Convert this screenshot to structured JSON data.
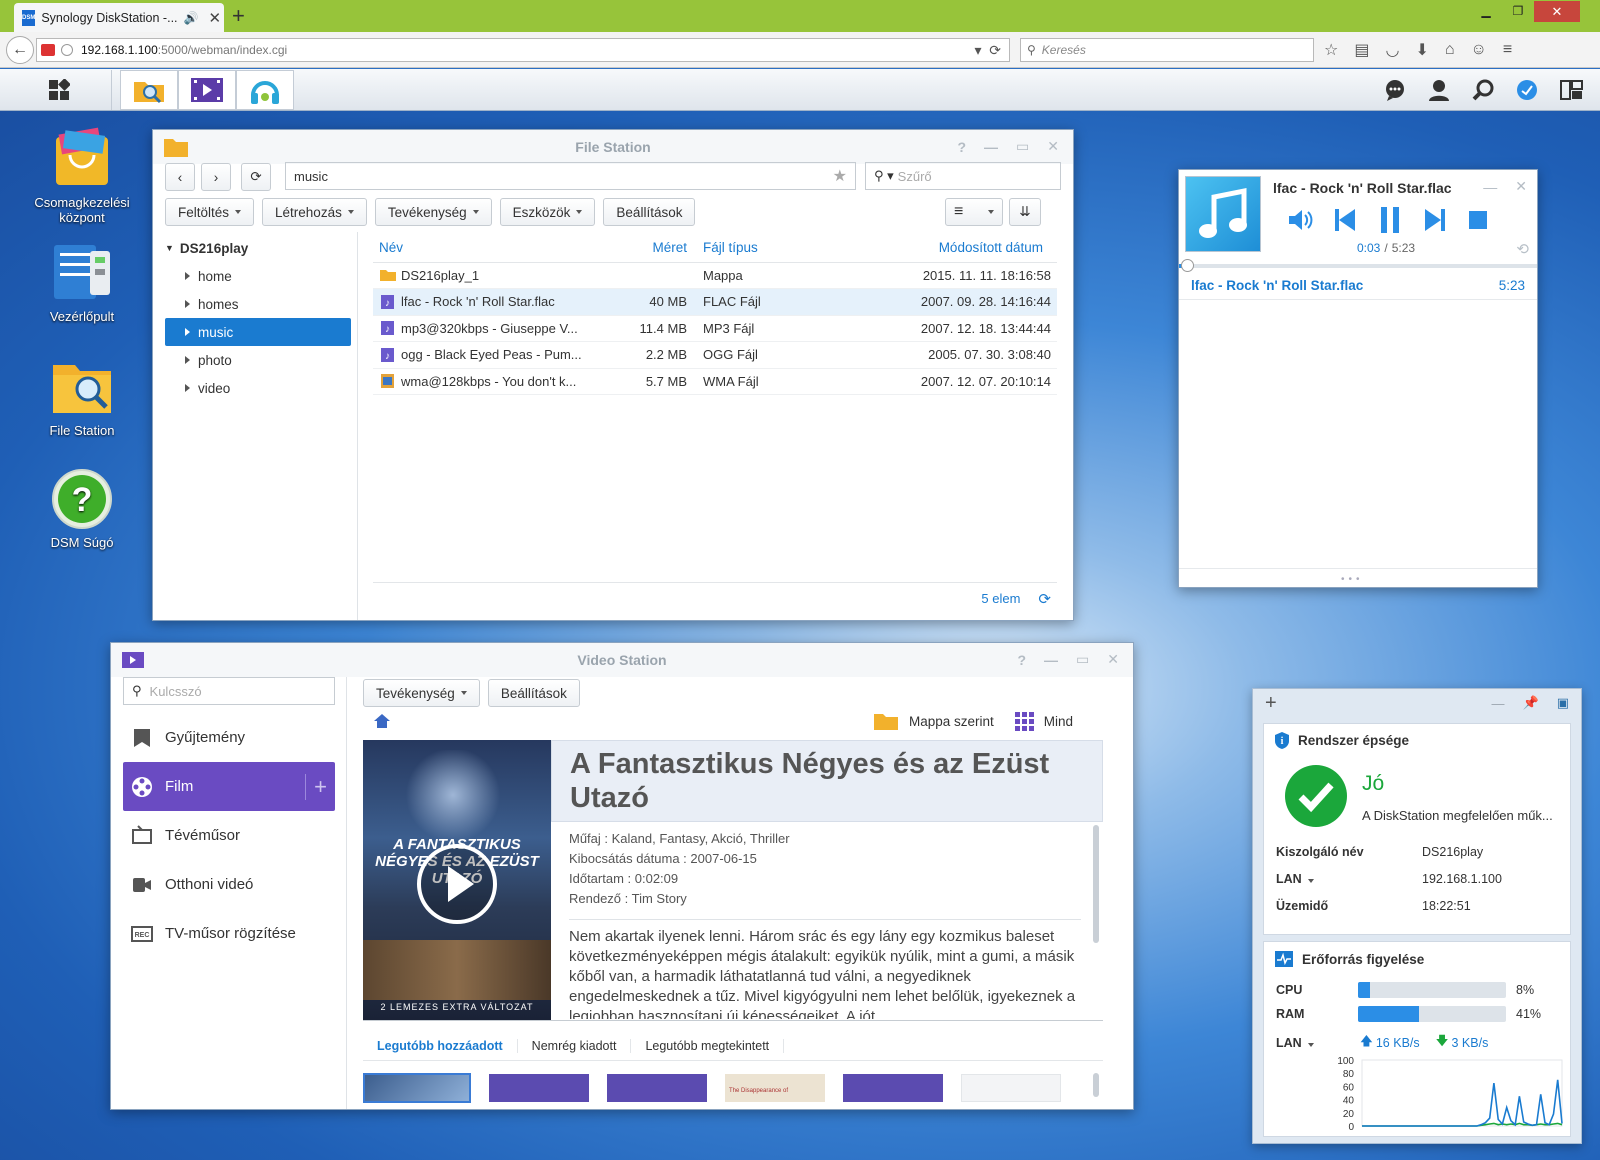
{
  "browser": {
    "tab_title": "Synology DiskStation -...",
    "url_host": "192.168.1.100",
    "url_rest": ":5000/webman/index.cgi",
    "search_placeholder": "Keresés"
  },
  "desktop": {
    "icons": [
      {
        "label": "Csomagkezelési központ",
        "icon": "package-center-icon"
      },
      {
        "label": "Vezérlőpult",
        "icon": "control-panel-icon"
      },
      {
        "label": "File Station",
        "icon": "file-station-icon"
      },
      {
        "label": "DSM Súgó",
        "icon": "help-icon"
      }
    ]
  },
  "file_station": {
    "title": "File Station",
    "path": "music",
    "filter_placeholder": "Szűrő",
    "toolbar": [
      "Feltöltés",
      "Létrehozás",
      "Tevékenység",
      "Eszközök",
      "Beállítások"
    ],
    "tree_root": "DS216play",
    "tree": [
      "home",
      "homes",
      "music",
      "photo",
      "video"
    ],
    "selected_folder": "music",
    "columns": [
      "Név",
      "Méret",
      "Fájl típus",
      "Módosított dátum"
    ],
    "files": [
      {
        "name": "DS216play_1",
        "size": "",
        "type": "Mappa",
        "date": "2015. 11. 11. 18:16:58",
        "icon": "folder-icon"
      },
      {
        "name": "lfac - Rock 'n' Roll Star.flac",
        "size": "40 MB",
        "type": "FLAC Fájl",
        "date": "2007. 09. 28. 14:16:44",
        "icon": "music-file-icon"
      },
      {
        "name": "mp3@320kbps - Giuseppe V...",
        "size": "11.4 MB",
        "type": "MP3 Fájl",
        "date": "2007. 12. 18. 13:44:44",
        "icon": "music-file-icon"
      },
      {
        "name": "ogg - Black Eyed Peas - Pum...",
        "size": "2.2 MB",
        "type": "OGG Fájl",
        "date": "2005. 07. 30. 3:08:40",
        "icon": "music-file-icon"
      },
      {
        "name": "wma@128kbps - You don't k...",
        "size": "5.7 MB",
        "type": "WMA Fájl",
        "date": "2007. 12. 07. 20:10:14",
        "icon": "video-file-icon"
      }
    ],
    "count": "5 elem"
  },
  "audio_player": {
    "track": "lfac - Rock 'n' Roll Star.flac",
    "elapsed": "0:03",
    "separator": "/",
    "total": "5:23",
    "playlist": [
      {
        "title": "lfac - Rock 'n' Roll Star.flac",
        "duration": "5:23"
      }
    ]
  },
  "video_station": {
    "title": "Video Station",
    "search_placeholder": "Kulcsszó",
    "nav": [
      {
        "label": "Gyűjtemény",
        "icon": "bookmark-icon"
      },
      {
        "label": "Film",
        "icon": "film-reel-icon"
      },
      {
        "label": "Tévéműsor",
        "icon": "tv-icon"
      },
      {
        "label": "Otthoni videó",
        "icon": "camcorder-icon"
      },
      {
        "label": "TV-műsor rögzítése",
        "icon": "rec-icon"
      }
    ],
    "active_nav": "Film",
    "buttons": [
      "Tevékenység",
      "Beállítások"
    ],
    "view_folder": "Mappa szerint",
    "view_all": "Mind",
    "movie": {
      "title": "A Fantasztikus Négyes és az Ezüst Utazó",
      "genre": "Műfaj : Kaland, Fantasy, Akció, Thriller",
      "release": "Kibocsátás dátuma : 2007-06-15",
      "duration": "Időtartam : 0:02:09",
      "director": "Rendező : Tim Story",
      "description": "Nem akartak ilyenek lenni. Három srác és egy lány egy kozmikus baleset következményeképpen mégis átalakult: egyikük nyúlik, mint a gumi, a másik kőből van, a harmadik láthatatlanná tud válni, a negyediknek engedelmeskednek a tűz. Mivel kigyógyulni nem lehet belőlük, igyekeznek a legjobban hasznosítani új képességeiket. A jót",
      "poster_text": "A FANTASZTIKUS NÉGYES ÉS AZ EZÜST UTAZÓ",
      "poster_caption": "2 LEMEZES EXTRA VÁLTOZAT"
    },
    "tabs": [
      "Legutóbb hozzáadott",
      "Nemrég kiadott",
      "Legutóbb megtekintett"
    ],
    "active_tab": "Legutóbb hozzáadott",
    "thumb_text": "The Disappearance of"
  },
  "widget": {
    "health_title": "Rendszer épsége",
    "status": "Jó",
    "status_text": "A DiskStation megfelelően műk...",
    "rows": [
      {
        "label": "Kiszolgáló név",
        "value": "DS216play"
      },
      {
        "label": "LAN",
        "value": "192.168.1.100"
      },
      {
        "label": "Üzemidő",
        "value": "18:22:51"
      }
    ],
    "monitor_title": "Erőforrás figyelése",
    "cpu_label": "CPU",
    "cpu": "8%",
    "cpu_level": 8,
    "ram_label": "RAM",
    "ram": "41%",
    "ram_level": 41,
    "lan_label": "LAN",
    "lan_up": "16 KB/s",
    "lan_down": "3 KB/s",
    "graph_ticks": [
      "100",
      "80",
      "60",
      "40",
      "20",
      "0"
    ],
    "graph_up": [
      0,
      0,
      0,
      0,
      0,
      0,
      0,
      0,
      0,
      0,
      0,
      0,
      0,
      0,
      0,
      0,
      0,
      0,
      0,
      0,
      0,
      0,
      0,
      0,
      0,
      0,
      0,
      0,
      2,
      5,
      12,
      65,
      10,
      3,
      28,
      8,
      2,
      45,
      6,
      3,
      1,
      2,
      48,
      5,
      2,
      18,
      70,
      4
    ],
    "graph_down": [
      0,
      0,
      0,
      0,
      0,
      0,
      0,
      0,
      0,
      0,
      0,
      0,
      0,
      0,
      0,
      0,
      0,
      0,
      0,
      0,
      0,
      0,
      0,
      0,
      0,
      0,
      0,
      0,
      1,
      2,
      3,
      4,
      2,
      3,
      2,
      3,
      2,
      4,
      2,
      2,
      1,
      2,
      3,
      2,
      2,
      3,
      4,
      2
    ]
  },
  "colors": {
    "accent": "#1a7bd0",
    "video_purple": "#6a4bc2",
    "ok_green": "#1ba73b",
    "titlebar": "#97c43a"
  }
}
